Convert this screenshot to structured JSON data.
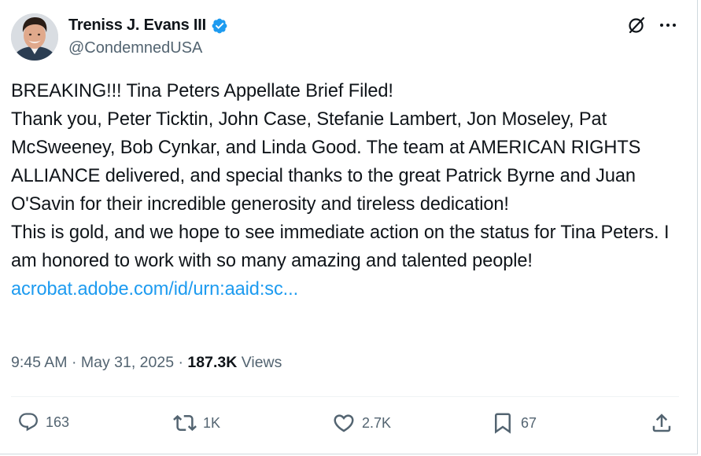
{
  "author": {
    "display_name": "Treniss J. Evans III",
    "handle": "@CondemnedUSA",
    "verified": true,
    "verified_color": "#1d9bf0"
  },
  "tweet": {
    "lines": [
      "BREAKING!!! Tina Peters Appellate Brief Filed!",
      "Thank you, Peter Ticktin, John Case, Stefanie Lambert, Jon Moseley, Pat McSweeney, Bob Cynkar, and Linda Good.  The team at AMERICAN RIGHTS ALLIANCE delivered, and special thanks to the great Patrick Byrne and Juan O'Savin for their incredible generosity and tireless dedication!",
      "This is gold, and we hope to see immediate action on the status for Tina Peters. I am honored to work with so many amazing and talented people!"
    ],
    "link_text": "acrobat.adobe.com/id/urn:aaid:sc...",
    "link_color": "#1d9bf0"
  },
  "meta": {
    "time": "9:45 AM",
    "separator": "·",
    "date": "May 31, 2025",
    "views_count": "187.3K",
    "views_label": "Views"
  },
  "actions": {
    "replies": "163",
    "reposts": "1K",
    "likes": "2.7K",
    "bookmarks": "67"
  },
  "icons": {
    "grok": "grok-icon",
    "more": "more-icon",
    "reply": "reply-icon",
    "repost": "repost-icon",
    "like": "heart-icon",
    "bookmark": "bookmark-icon",
    "share": "share-icon"
  },
  "colors": {
    "text": "#0f1419",
    "secondary": "#536471",
    "border": "#cfd9de"
  }
}
